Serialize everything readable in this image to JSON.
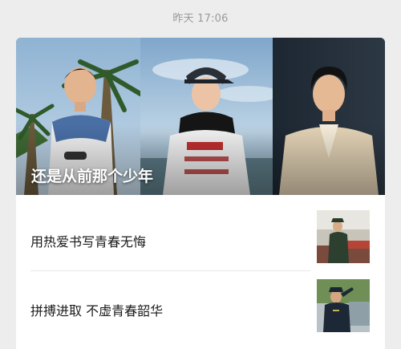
{
  "message": {
    "timestamp": "昨天 17:06"
  },
  "article_card": {
    "cover_title": "还是从前那个少年",
    "sub_articles": [
      {
        "title": "用热爱书写青春无悔",
        "thumbnail": "man-in-uniform-at-podium-photo"
      },
      {
        "title": "拼搏进取 不虚青春韶华",
        "thumbnail": "officer-saluting-photo"
      }
    ],
    "cover_photos": [
      "young-man-with-palm-trees-photo",
      "girl-in-cap-photo",
      "woman-in-blazer-photo"
    ]
  }
}
